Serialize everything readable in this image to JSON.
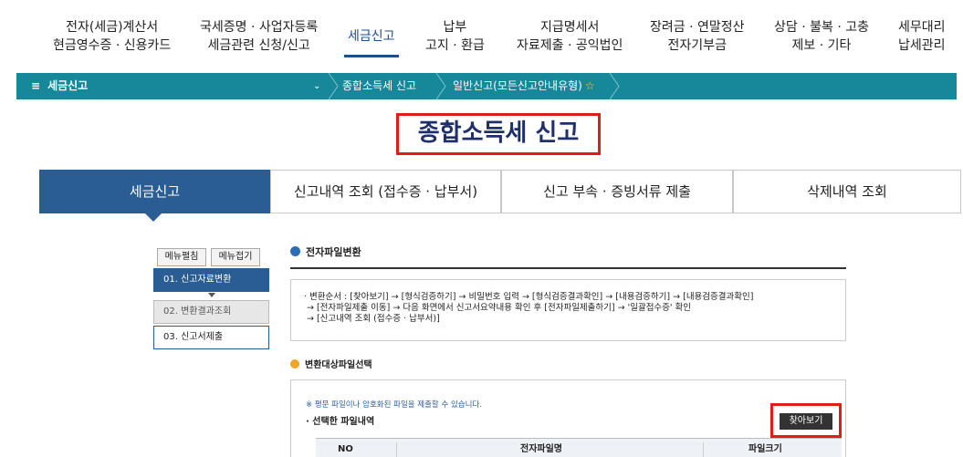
{
  "topnav": [
    {
      "line1": "전자(세금)계산서",
      "line2": "현금영수증 · 신용카드"
    },
    {
      "line1": "국세증명 · 사업자등록",
      "line2": "세금관련 신청/신고"
    },
    {
      "line1": "세금신고",
      "line2": ""
    },
    {
      "line1": "납부",
      "line2": "고지 · 환급"
    },
    {
      "line1": "지급명세서",
      "line2": "자료제출 · 공익법인"
    },
    {
      "line1": "장려금 · 연말정산",
      "line2": "전자기부금"
    },
    {
      "line1": "상담 · 불복 · 고충",
      "line2": "제보 · 기타"
    },
    {
      "line1": "세무대리",
      "line2": "납세관리"
    }
  ],
  "breadcrumb": {
    "menu": "세금신고",
    "crumb1": "종합소득세 신고",
    "crumb2": "일반신고(모든신고안내유형)"
  },
  "page_title": "종합소득세 신고",
  "tabs": [
    "세금신고",
    "신고내역 조회 (접수증 · 납부서)",
    "신고 부속 · 증빙서류 제출",
    "삭제내역 조회"
  ],
  "left_menu": {
    "expand": "메뉴펼침",
    "collapse": "메뉴접기",
    "steps": [
      "01. 신고자료변환",
      "02. 변환결과조회",
      "03. 신고서제출"
    ]
  },
  "section1": {
    "title": "전자파일변환",
    "lines": [
      "· 변환순서 : [찾아보기] → [형식검증하기] → 비밀번호 입력 → [형식검증결과확인] → [내용검증하기] → [내용검증결과확인]",
      "→ [전자파일제출 이동] → 다음 화면에서 신고서요약내용 확인 후 [전자파일제출하기] → '일괄접수증' 확인",
      "→ [신고내역 조회 (접수증 · 납부서)]"
    ]
  },
  "section2": {
    "title": "변환대상파일선택",
    "note": "※ 평문 파일이나 암호화된 파일을 제출할 수 있습니다.",
    "selected": "· 선택한 파일내역",
    "find_button": "찾아보기",
    "columns": [
      "NO",
      "전자파일명",
      "파일크기"
    ]
  },
  "colors": {
    "teal_bar": "#17889a",
    "tab_active": "#2a5d93",
    "title_text": "#1f2f6b",
    "highlight_red": "#e21b1b"
  }
}
